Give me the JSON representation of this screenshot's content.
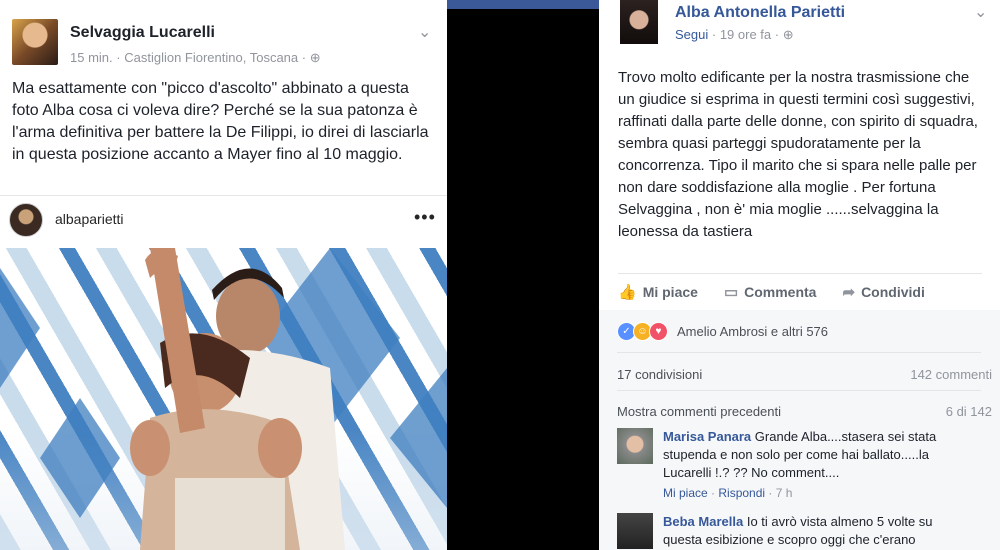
{
  "left_post": {
    "author": "Selvaggia Lucarelli",
    "time": "15 min.",
    "location": "Castiglion Fiorentino, Toscana",
    "text": "Ma esattamente con \"picco d'ascolto\" abbinato a questa foto Alba cosa ci voleva dire? Perché se la sua patonza è l'arma definitiva per battere la De Filippi, io direi di lasciarla in questa posizione accanto a Mayer fino al 10 maggio.",
    "embed": {
      "username": "albaparietti",
      "more": "•••"
    }
  },
  "right_post": {
    "author": "Alba Antonella Parietti",
    "follow": "Segui",
    "time": "19 ore fa",
    "text": "Trovo molto edificante per la nostra trasmissione che un giudice si esprima in questi termini così suggestivi, raffinati dalla parte delle donne, con spirito di squadra, sembra quasi parteggi spudoratamente per la concorrenza. Tipo il marito che si spara nelle palle per non dare soddisfazione alla moglie . Per fortuna Selvaggina , non è' mia moglie ......selvaggina la leonessa da tastiera",
    "actions": {
      "like": "Mi piace",
      "comment": "Commenta",
      "share": "Condividi"
    },
    "reactions": {
      "text": "Amelio Ambrosi e altri 576",
      "colors": [
        "#5890ff",
        "#f7b125",
        "#f25268"
      ]
    },
    "shares": "17 condivisioni",
    "comments_count": "142 commenti",
    "more_comments": "Mostra commenti precedenti",
    "more_count": "6 di 142",
    "comments": [
      {
        "name": "Marisa Panara",
        "text": "Grande Alba....stasera sei stata stupenda e non solo per come hai ballato.....la Lucarelli !.? ?? No comment....",
        "like": "Mi piace",
        "reply": "Rispondi",
        "time": "7 h"
      },
      {
        "name": "Beba Marella",
        "text": "Io ti avrò vista almeno 5 volte su questa esibizione e scopro oggi che c'erano"
      }
    ]
  }
}
